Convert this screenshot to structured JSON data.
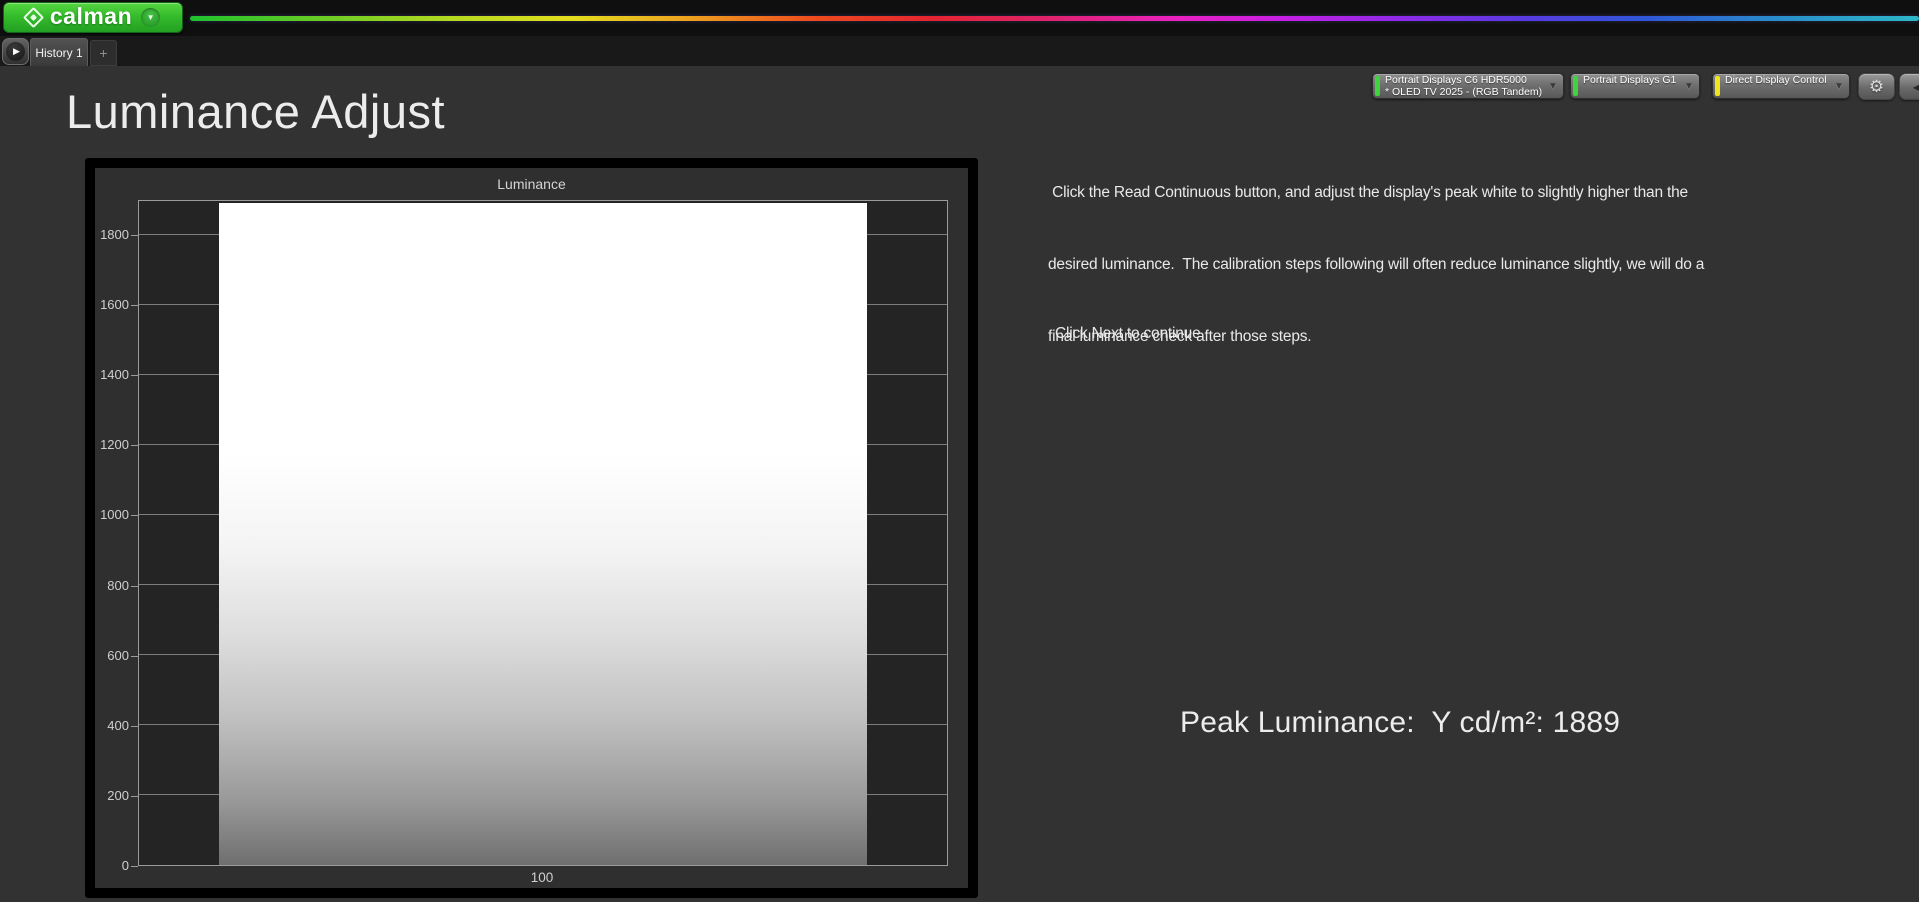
{
  "brand": {
    "logo_text": "calman"
  },
  "icons": {
    "logo_dropdown": "▼",
    "nav_forward": "▶",
    "device_chevron": "▼",
    "settings": "⚙",
    "collapse": "◀"
  },
  "tab_bar": {
    "tabs": [
      {
        "label": "History 1",
        "selected": true
      }
    ],
    "add_tab_label": "+"
  },
  "device_bar": {
    "devices": [
      {
        "line1": "Portrait Displays C6 HDR5000",
        "line2": "* OLED TV 2025 - (RGB Tandem)",
        "accent_color": "#3fd43f"
      },
      {
        "line1": "Portrait Displays G1",
        "line2": "",
        "accent_color": "#3fd43f"
      },
      {
        "line1": "Direct Display Control",
        "line2": "",
        "accent_color": "#efe51f"
      }
    ]
  },
  "content": {
    "title": "Luminance Adjust",
    "instructions_lines": [
      " Click the Read Continuous button, and adjust the display's peak white to slightly higher than the",
      "desired luminance.  The calibration steps following will often reduce luminance slightly, we will do a",
      "final luminance check after those steps."
    ],
    "next_hint": "Click Next to continue.",
    "peak_readout": "Peak Luminance:  Y cd/m²: 1889"
  },
  "chart_data": {
    "type": "bar",
    "title": "Luminance",
    "categories": [
      "100"
    ],
    "values": [
      1889
    ],
    "xlabel": "",
    "ylabel": "",
    "ylim": [
      0,
      1900
    ],
    "yticks": [
      0,
      200,
      400,
      600,
      800,
      1000,
      1200,
      1400,
      1600,
      1800
    ],
    "grid": true,
    "legend": "none",
    "bar_color": "#ffffff"
  }
}
